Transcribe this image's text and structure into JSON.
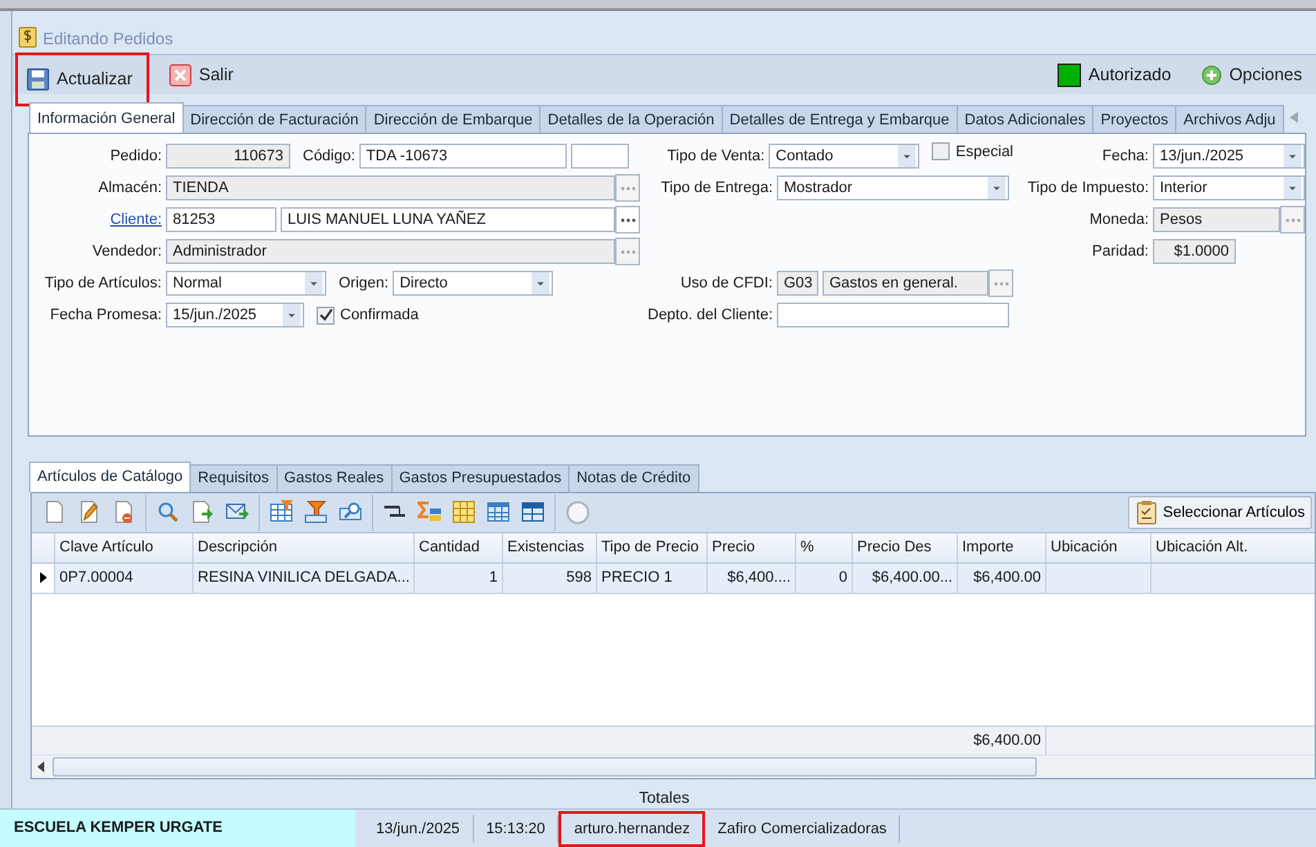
{
  "window": {
    "title": "Editando Pedidos"
  },
  "toolbar": {
    "buttons": [
      {
        "kind": "save",
        "label": "Actualizar",
        "highlighted": true
      },
      {
        "kind": "close",
        "label": "Salir",
        "highlighted": false
      }
    ],
    "status": {
      "label": "Autorizado",
      "color": "#00b000"
    },
    "options": {
      "label": "Opciones"
    }
  },
  "tabs": [
    {
      "label": "Información General",
      "selected": true
    },
    {
      "label": "Dirección de Facturación",
      "selected": false
    },
    {
      "label": "Dirección de Embarque",
      "selected": false
    },
    {
      "label": "Detalles de la Operación",
      "selected": false
    },
    {
      "label": "Detalles de Entrega y Embarque",
      "selected": false
    },
    {
      "label": "Datos Adicionales",
      "selected": false
    },
    {
      "label": "Proyectos",
      "selected": false
    },
    {
      "label": "Archivos Adju",
      "selected": false
    }
  ],
  "form": {
    "left": [
      [
        {
          "kind": "label",
          "text": "Pedido:"
        },
        {
          "kind": "number",
          "value": "110673",
          "readonly": true
        },
        {
          "kind": "label",
          "text": "Código:"
        },
        {
          "kind": "text",
          "value": "TDA  -10673",
          "readonly": false
        },
        {
          "kind": "text",
          "readonly": false
        }
      ],
      [
        {
          "kind": "label",
          "text": "Almacén:"
        },
        {
          "kind": "text",
          "value": "TIENDA",
          "readonly": true
        },
        {
          "kind": "lookup",
          "disabled": true
        }
      ],
      [
        {
          "kind": "link",
          "text": "Cliente:"
        },
        {
          "kind": "text",
          "value": "81253",
          "readonly": false
        },
        {
          "kind": "text",
          "value": "LUIS MANUEL LUNA YAÑEZ",
          "readonly": false
        },
        {
          "kind": "lookup",
          "disabled": false
        }
      ],
      [
        {
          "kind": "label",
          "text": "Vendedor:"
        },
        {
          "kind": "text",
          "value": "Administrador",
          "readonly": true
        },
        {
          "kind": "lookup",
          "disabled": true
        }
      ],
      [
        {
          "kind": "label",
          "text": "Tipo de Artículos:"
        },
        {
          "kind": "combo",
          "value": "Normal"
        },
        {
          "kind": "label",
          "text": "Origen:"
        },
        {
          "kind": "combo",
          "value": "Directo"
        }
      ],
      [
        {
          "kind": "label",
          "text": "Fecha Promesa:"
        },
        {
          "kind": "combo",
          "value": "15/jun./2025"
        },
        {
          "kind": "check",
          "text": "Confirmada",
          "checked": true
        }
      ]
    ],
    "middle": [
      [
        {
          "kind": "label",
          "text": "Tipo de Venta:"
        },
        {
          "kind": "combo",
          "value": "Contado"
        },
        {
          "kind": "check",
          "text": "Especial",
          "checked": false
        }
      ],
      [
        {
          "kind": "label",
          "text": "Tipo de Entrega:"
        },
        {
          "kind": "combo",
          "value": "Mostrador"
        }
      ],
      [
        {
          "kind": "label",
          "text": "Uso de CFDI:"
        },
        {
          "kind": "text",
          "value": "G03",
          "readonly": true
        },
        {
          "kind": "text",
          "value": "Gastos en general.",
          "readonly": true
        },
        {
          "kind": "lookup",
          "disabled": true
        }
      ],
      [
        {
          "kind": "label",
          "text": "Depto. del Cliente:"
        },
        {
          "kind": "text",
          "readonly": false
        }
      ]
    ],
    "right": [
      [
        {
          "kind": "label",
          "text": "Fecha:"
        },
        {
          "kind": "combo",
          "value": "13/jun./2025"
        }
      ],
      [
        {
          "kind": "label",
          "text": "Tipo de Impuesto:"
        },
        {
          "kind": "combo",
          "value": "Interior"
        }
      ],
      [
        {
          "kind": "label",
          "text": "Moneda:"
        },
        {
          "kind": "text",
          "value": "Pesos",
          "readonly": true
        },
        {
          "kind": "lookup",
          "disabled": true
        }
      ],
      [
        {
          "kind": "label",
          "text": "Paridad:"
        },
        {
          "kind": "number",
          "value": "$1.0000",
          "readonly": true
        }
      ]
    ]
  },
  "detail_tabs": [
    {
      "label": "Artículos de Catálogo",
      "selected": true
    },
    {
      "label": "Requisitos",
      "selected": false
    },
    {
      "label": "Gastos Reales",
      "selected": false
    },
    {
      "label": "Gastos Presupuestados",
      "selected": false
    },
    {
      "label": "Notas de Crédito",
      "selected": false
    }
  ],
  "select_button": {
    "label": "Seleccionar Artículos"
  },
  "table": {
    "columns": [
      "Clave Artículo",
      "Descripción",
      "Cantidad",
      "Existencias",
      "Tipo de Precio",
      "Precio",
      "%",
      "Precio Des",
      "Importe",
      "Ubicación",
      "Ubicación Alt."
    ],
    "rows": [
      {
        "current": true,
        "cells": [
          "0P7.00004",
          "RESINA VINILICA DELGADA...",
          "1",
          "598",
          "PRECIO 1",
          "$6,400....",
          "0",
          "$6,400.00...",
          "$6,400.00",
          "",
          ""
        ]
      }
    ],
    "totals": {
      "importe": "$6,400.00"
    }
  },
  "totals_label": "Totales",
  "status_bar": [
    {
      "text": "ESCUELA KEMPER URGATE",
      "kind": "company",
      "highlighted": false
    },
    {
      "text": "13/jun./2025",
      "kind": "plain",
      "highlighted": false
    },
    {
      "text": "15:13:20",
      "kind": "plain",
      "highlighted": false
    },
    {
      "text": "arturo.hernandez",
      "kind": "plain",
      "highlighted": true
    },
    {
      "text": "Zafiro Comercializadoras",
      "kind": "plain",
      "highlighted": false
    }
  ]
}
